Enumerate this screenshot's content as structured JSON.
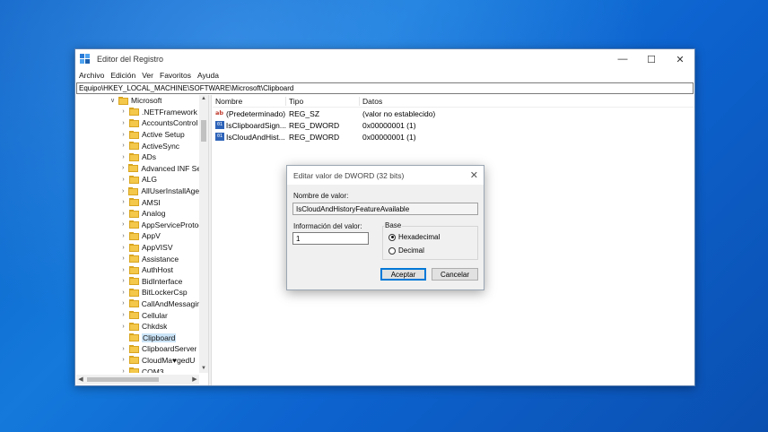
{
  "window": {
    "title": "Editor del Registro",
    "controls": {
      "minimize": "—",
      "maximize": "☐",
      "close": "✕"
    }
  },
  "menu": [
    "Archivo",
    "Edición",
    "Ver",
    "Favoritos",
    "Ayuda"
  ],
  "address": "Equipo\\HKEY_LOCAL_MACHINE\\SOFTWARE\\Microsoft\\Clipboard",
  "tree": {
    "parent": "Microsoft",
    "items": [
      ".NETFramework",
      "AccountsControl",
      "Active Setup",
      "ActiveSync",
      "ADs",
      "Advanced INF Set",
      "ALG",
      "AllUserInstallAgen",
      "AMSI",
      "Analog",
      "AppServiceProtoc",
      "AppV",
      "AppVISV",
      "Assistance",
      "AuthHost",
      "BidInterface",
      "BitLockerCsp",
      "CallAndMessagin",
      "Cellular",
      "Chkdsk",
      "Clipboard",
      "ClipboardServer",
      "CloudMa♥gedU",
      "COM3"
    ],
    "selected": "Clipboard"
  },
  "values": {
    "headers": {
      "name": "Nombre",
      "type": "Tipo",
      "data": "Datos"
    },
    "rows": [
      {
        "icon": "string-value-icon",
        "name": "(Predeterminado)",
        "type": "REG_SZ",
        "data": "(valor no establecido)"
      },
      {
        "icon": "binary-value-icon",
        "name": "IsClipboardSign...",
        "type": "REG_DWORD",
        "data": "0x00000001 (1)"
      },
      {
        "icon": "binary-value-icon",
        "name": "IsCloudAndHist...",
        "type": "REG_DWORD",
        "data": "0x00000001 (1)"
      }
    ]
  },
  "dialog": {
    "title": "Editar valor de DWORD (32 bits)",
    "name_label": "Nombre de valor:",
    "name_value": "IsCloudAndHistoryFeatureAvailable",
    "data_label": "Información del valor:",
    "data_value": "1",
    "base_label": "Base",
    "hex_label": "Hexadecimal",
    "dec_label": "Decimal",
    "base_selected": "Hexadecimal",
    "ok_label": "Aceptar",
    "cancel_label": "Cancelar"
  }
}
